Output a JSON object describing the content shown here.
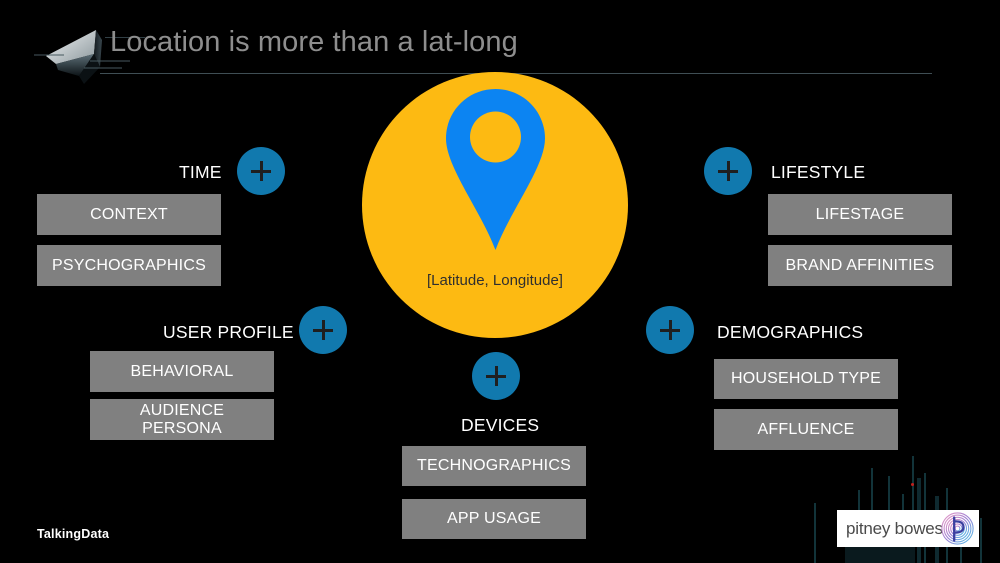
{
  "header": {
    "title": "Location is more than a lat-long",
    "logo_icon": "paper-plane-icon"
  },
  "center": {
    "pin_icon": "map-pin-icon",
    "caption": "[Latitude, Longitude]",
    "circle_color": "#FDBA12",
    "pin_color": "#0C84F2"
  },
  "badge_glyph": "+",
  "groups": [
    {
      "id": "time",
      "label": "TIME",
      "chips": [
        "CONTEXT",
        "PSYCHOGRAPHICS"
      ]
    },
    {
      "id": "user-profile",
      "label": "USER PROFILE",
      "chips": [
        "BEHAVIORAL",
        "AUDIENCE\nPERSONA"
      ]
    },
    {
      "id": "devices",
      "label": "DEVICES",
      "chips": [
        "TECHNOGRAPHICS",
        "APP USAGE"
      ]
    },
    {
      "id": "lifestyle",
      "label": "LIFESTYLE",
      "chips": [
        "LIFESTAGE",
        "BRAND AFFINITIES"
      ]
    },
    {
      "id": "demographics",
      "label": "DEMOGRAPHICS",
      "chips": [
        "HOUSEHOLD TYPE",
        "AFFLUENCE"
      ]
    }
  ],
  "chip_labels": {
    "context": "CONTEXT",
    "psychographics": "PSYCHOGRAPHICS",
    "behavioral": "BEHAVIORAL",
    "audience_persona_line1": "AUDIENCE",
    "audience_persona_line2": "PERSONA",
    "technographics": "TECHNOGRAPHICS",
    "app_usage": "APP USAGE",
    "lifestage": "LIFESTAGE",
    "brand_affinities": "BRAND AFFINITIES",
    "household_type": "HOUSEHOLD TYPE",
    "affluence": "AFFLUENCE"
  },
  "footer": {
    "talkingdata": "TalkingData",
    "pitney_bowes": "pitney bowes",
    "pitney_bowes_mark": "pitney-bowes-p-icon"
  },
  "colors": {
    "background": "#000000",
    "chip": "#808080",
    "badge": "#1179AE",
    "title": "#8E8E8E",
    "accent_amber": "#FDBA12",
    "accent_blue": "#0C84F2"
  }
}
